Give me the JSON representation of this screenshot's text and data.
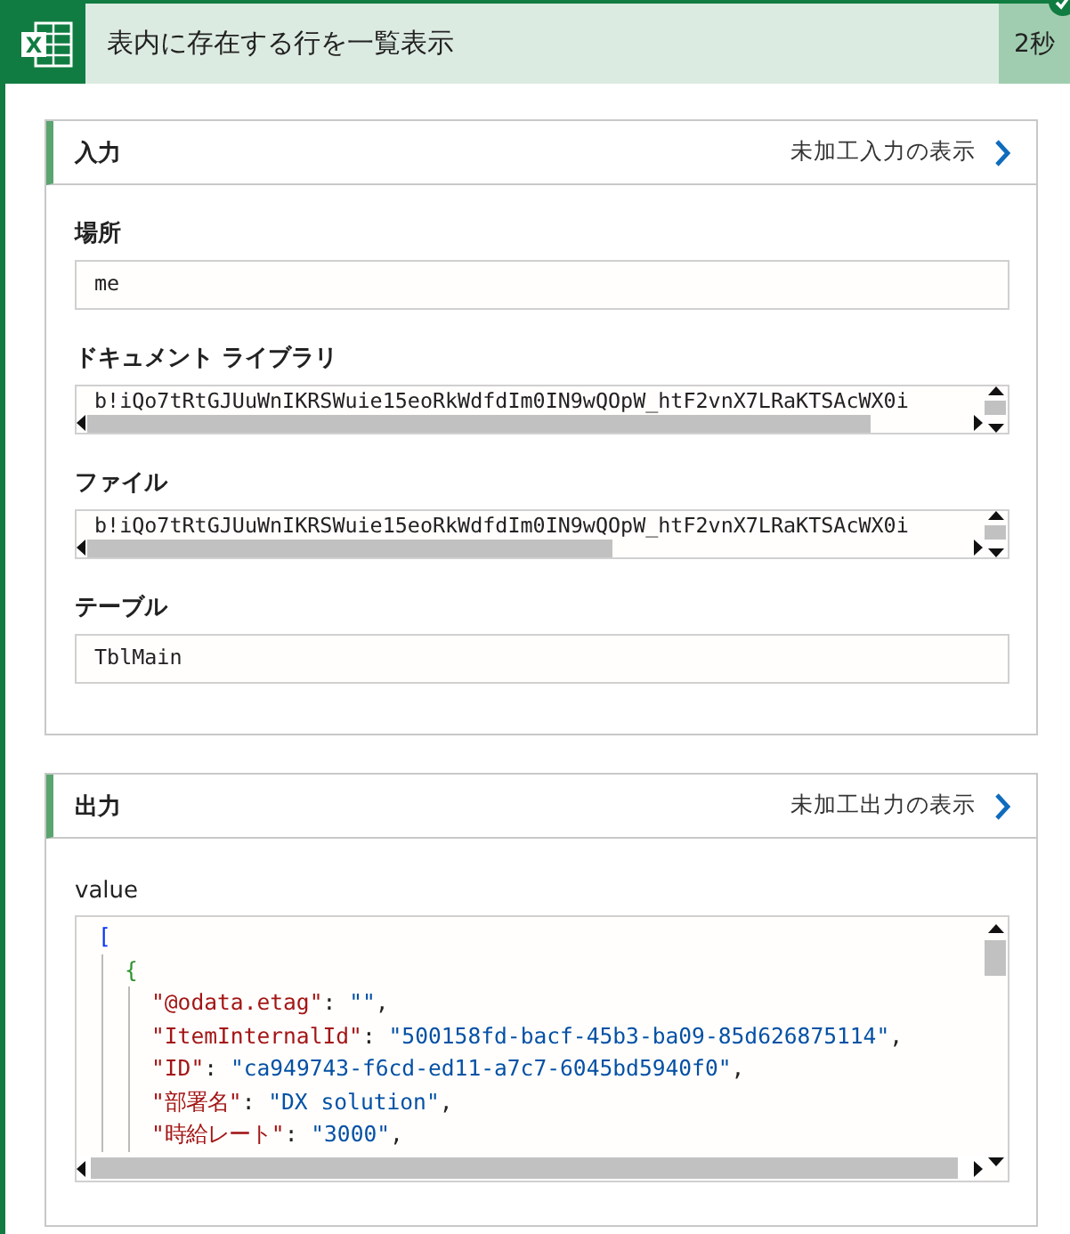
{
  "header": {
    "icon_text": "X",
    "title": "表内に存在する行を一覧表示",
    "duration": "2秒",
    "succeeded": true
  },
  "input": {
    "title": "入力",
    "link": "未加工入力の表示",
    "fields": [
      {
        "label": "場所",
        "kind": "plain",
        "value": "me"
      },
      {
        "label": "ドキュメント ライブラリ",
        "kind": "scroll",
        "value": "b!iQo7tRtGJUuWnIKRSWuie15eoRkWdfdIm0IN9wQOpW_htF2vnX7LRaKTSAcWX0i"
      },
      {
        "label": "ファイル",
        "kind": "scroll",
        "value": "b!iQo7tRtGJUuWnIKRSWuie15eoRkWdfdIm0IN9wQOpW_htF2vnX7LRaKTSAcWX0i"
      },
      {
        "label": "テーブル",
        "kind": "plain",
        "value": "TblMain"
      }
    ]
  },
  "output": {
    "title": "出力",
    "link": "未加工出力の表示",
    "label": "value",
    "code": {
      "open": "[",
      "children": [
        {
          "open": "{",
          "children": [
            {
              "key": "\"@odata.etag\"",
              "colon": ": ",
              "value": "\"\"",
              "comma": ","
            },
            {
              "key": "\"ItemInternalId\"",
              "colon": ": ",
              "value": "\"500158fd-bacf-45b3-ba09-85d626875114\"",
              "comma": ","
            },
            {
              "key": "\"ID\"",
              "colon": ": ",
              "value": "\"ca949743-f6cd-ed11-a7c7-6045bd5940f0\"",
              "comma": ","
            },
            {
              "key": "\"部署名\"",
              "colon": ": ",
              "value": "\"DX solution\"",
              "comma": ","
            },
            {
              "key": "\"時給レート\"",
              "colon": ": ",
              "value": "\"3000\"",
              "comma": ","
            }
          ]
        }
      ]
    }
  }
}
